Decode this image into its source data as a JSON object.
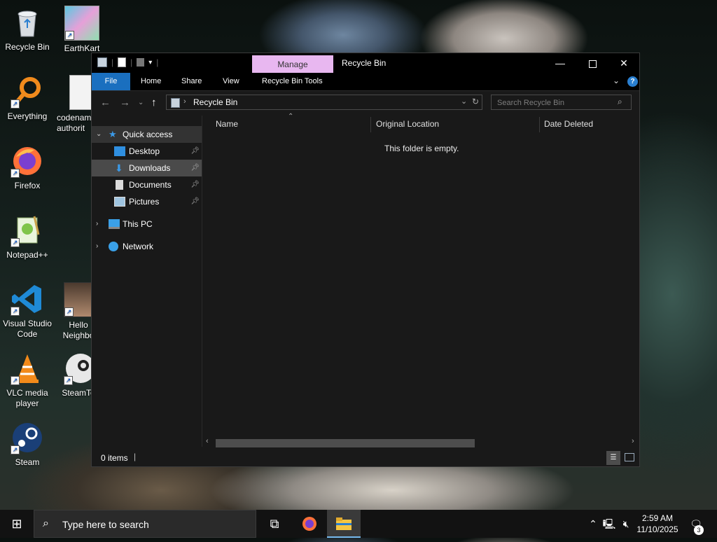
{
  "desktop": {
    "icons": [
      {
        "label": "Recycle Bin"
      },
      {
        "label": "EarthKart"
      },
      {
        "label": "Everything"
      },
      {
        "label": "codenam authorit"
      },
      {
        "label": "Firefox"
      },
      {
        "label": "Notepad++"
      },
      {
        "label": "Visual Studio Code"
      },
      {
        "label": "Hello Neighbo"
      },
      {
        "label": "VLC media player"
      },
      {
        "label": "SteamTo"
      },
      {
        "label": "Steam"
      }
    ]
  },
  "window": {
    "title": "Recycle Bin",
    "manage_tab": "Manage",
    "ribbon_tabs": [
      "File",
      "Home",
      "Share",
      "View",
      "Recycle Bin Tools"
    ],
    "address": {
      "crumb": "Recycle Bin"
    },
    "search": {
      "placeholder": "Search Recycle Bin"
    },
    "nav": {
      "quick_access": "Quick access",
      "desktop": "Desktop",
      "downloads": "Downloads",
      "documents": "Documents",
      "pictures": "Pictures",
      "this_pc": "This PC",
      "network": "Network"
    },
    "columns": [
      "Name",
      "Original Location",
      "Date Deleted"
    ],
    "empty_message": "This folder is empty.",
    "status": {
      "items": "0 items"
    }
  },
  "taskbar": {
    "search_placeholder": "Type here to search",
    "time": "2:59 AM",
    "date": "11/10/2025",
    "notification_count": "3"
  },
  "colors": {
    "manage_tab": "#e8b7f0",
    "file_tab": "#1a6fbf",
    "window_bg": "#191919",
    "taskbar_bg": "#121212"
  }
}
